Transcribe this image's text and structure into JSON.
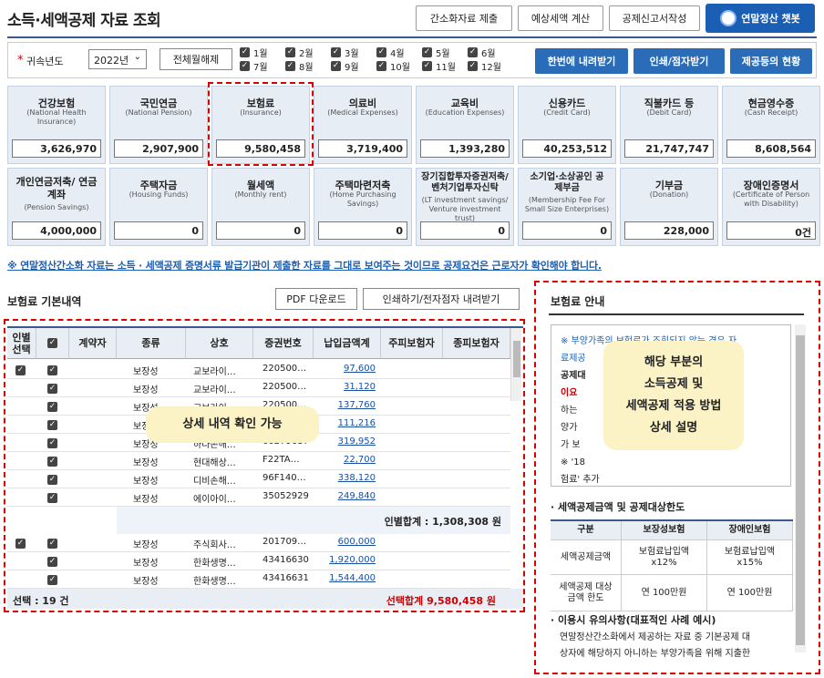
{
  "header": {
    "title": "소득·세액공제 자료 조회",
    "buttons": [
      "간소화자료 제출",
      "예상세액 계산",
      "공제신고서작성"
    ],
    "chatbot": "연말정산 챗봇"
  },
  "filter": {
    "year_label": "귀속년도",
    "year_value": "2022년",
    "toggle_all": "전체월해제",
    "months": [
      "1월",
      "2월",
      "3월",
      "4월",
      "5월",
      "6월",
      "7월",
      "8월",
      "9월",
      "10월",
      "11월",
      "12월"
    ],
    "buttons": [
      "한번에 내려받기",
      "인쇄/점자받기",
      "제공등의 현황"
    ]
  },
  "categories": [
    {
      "name": "건강보험",
      "en": "(National Health Insurance)",
      "amount": "3,626,970"
    },
    {
      "name": "국민연금",
      "en": "(National Pension)",
      "amount": "2,907,900"
    },
    {
      "name": "보험료",
      "en": "(Insurance)",
      "amount": "9,580,458"
    },
    {
      "name": "의료비",
      "en": "(Medical Expenses)",
      "amount": "3,719,400"
    },
    {
      "name": "교육비",
      "en": "(Education Expenses)",
      "amount": "1,393,280"
    },
    {
      "name": "신용카드",
      "en": "(Credit Card)",
      "amount": "40,253,512"
    },
    {
      "name": "직불카드 등",
      "en": "(Debit Card)",
      "amount": "21,747,747"
    },
    {
      "name": "현금영수증",
      "en": "(Cash Receipt)",
      "amount": "8,608,564"
    },
    {
      "name": "개인연금저축/ 연금계좌",
      "en": "(Pension Savings)",
      "amount": "4,000,000"
    },
    {
      "name": "주택자금",
      "en": "(Housing Funds)",
      "amount": "0"
    },
    {
      "name": "월세액",
      "en": "(Monthly rent)",
      "amount": "0"
    },
    {
      "name": "주택마련저축",
      "en": "(Home Purchasing Savings)",
      "amount": "0"
    },
    {
      "name": "장기집합투자증권저축/ 벤처기업투자신탁",
      "en": "(LT investment savings/ Venture investment trust)",
      "amount": "0"
    },
    {
      "name": "소기업·소상공인 공제부금",
      "en": "(Membership Fee For Small Size Enterprises)",
      "amount": "0"
    },
    {
      "name": "기부금",
      "en": "(Donation)",
      "amount": "228,000"
    },
    {
      "name": "장애인증명서",
      "en": "(Certificate of Person with Disability)",
      "amount": "0건"
    }
  ],
  "notice": "※ 연말정산간소화 자료는 소득 · 세액공제 증명서류 발급기관이 제출한 자료를 그대로 보여주는 것이므로 공제요건은 근로자가 확인해야 합니다.",
  "details": {
    "title": "보험료 기본내역",
    "pdf_button": "PDF 다운로드",
    "print_button": "인쇄하기/전자점자 내려받기",
    "columns": [
      "인별 선택",
      "✓",
      "계약자",
      "종류",
      "상호",
      "증권번호",
      "납입금액계",
      "주피보험자",
      "종피보험자"
    ],
    "group1": [
      {
        "type": "보장성",
        "company": "교보라이…",
        "policy": "220500…",
        "amount": "97,600"
      },
      {
        "type": "보장성",
        "company": "교보라이…",
        "policy": "220500…",
        "amount": "31,120"
      },
      {
        "type": "보장성",
        "company": "교보라이…",
        "policy": "220500…",
        "amount": "137,760"
      },
      {
        "type": "보장성",
        "company": "",
        "policy": "",
        "amount": "111,216"
      },
      {
        "type": "보장성",
        "company": "하나손해…",
        "policy": "60279687",
        "amount": "319,952"
      },
      {
        "type": "보장성",
        "company": "현대해상…",
        "policy": "F22TA…",
        "amount": "22,700"
      },
      {
        "type": "보장성",
        "company": "디비손해…",
        "policy": "96F140…",
        "amount": "338,120"
      },
      {
        "type": "보장성",
        "company": "에이아이…",
        "policy": "35052929",
        "amount": "249,840"
      }
    ],
    "subtotal": "인별합계 : 1,308,308 원",
    "group2": [
      {
        "type": "보장성",
        "company": "주식회사…",
        "policy": "201709…",
        "amount": "600,000"
      },
      {
        "type": "보장성",
        "company": "한화생명…",
        "policy": "43416630",
        "amount": "1,920,000"
      },
      {
        "type": "보장성",
        "company": "한화생명…",
        "policy": "43416631",
        "amount": "1,544,400"
      }
    ],
    "footer_selected": "선택 : 19 건",
    "footer_total": "선택합계 9,580,458 원",
    "overlay": "상세 내역 확인 가능"
  },
  "guide": {
    "title": "보험료 안내",
    "info_lines": [
      "※ 부양가족의 보험료가 조회되지 않는 경우 자",
      "료제공",
      "공제대",
      "이요",
      "하는",
      "양가",
      "가 보",
      "※ '18",
      "험료' 추가"
    ],
    "overlay": [
      "해당 부분의",
      "소득공제 및",
      "세액공제 적용 방법",
      "상세 설명"
    ],
    "limit_title": "세액공제금액 및 공제대상한도",
    "limit_head": [
      "구분",
      "보장성보험",
      "장애인보험"
    ],
    "limit_rows": [
      [
        "세액공제금액",
        "보험료납입액 x12%",
        "보험료납입액 x15%"
      ],
      [
        "세액공제 대상 금액 한도",
        "연 100만원",
        "연 100만원"
      ]
    ],
    "caution_title": "이용시 유의사항(대표적인 사례 예시)",
    "caution_lines": [
      "연말정산간소화에서 제공하는 자료 중 기본공제 대",
      "상자에 해당하지 아니하는 부양가족을 위해 지출한"
    ]
  }
}
